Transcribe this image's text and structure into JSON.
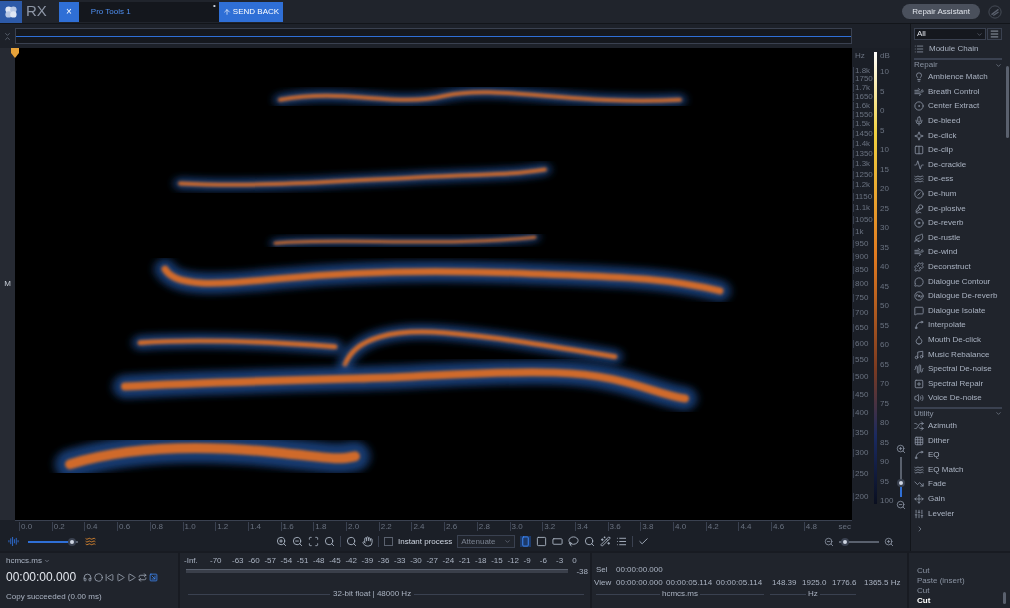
{
  "app": {
    "logo": "RX"
  },
  "document_tab": {
    "close": "×",
    "title": "Pro Tools 1",
    "mark": "•"
  },
  "send_back_button": "SEND BACK",
  "repair_assistant_button": "Repair Assistant",
  "spectrogram": {
    "channel_label": "M"
  },
  "frequency_axis": {
    "unit": "Hz",
    "labels": [
      "1.8k",
      "1750",
      "1.7k",
      "1650",
      "1.6k",
      "1550",
      "1.5k",
      "1450",
      "1.4k",
      "1350",
      "1.3k",
      "1250",
      "1.2k",
      "1150",
      "1.1k",
      "1050",
      "1k",
      "950",
      "900",
      "850",
      "800",
      "750",
      "700",
      "650",
      "600",
      "550",
      "500",
      "450",
      "400",
      "350",
      "300",
      "250",
      "200"
    ]
  },
  "level_axis": {
    "unit": "dB",
    "labels": [
      "10",
      "5",
      "0",
      "5",
      "10",
      "15",
      "20",
      "25",
      "30",
      "35",
      "40",
      "45",
      "50",
      "55",
      "60",
      "65",
      "70",
      "75",
      "80",
      "85",
      "90",
      "95",
      "100"
    ]
  },
  "vertical_zoom": {
    "level": 0.3
  },
  "time_axis": {
    "labels": [
      "0.0",
      "0.2",
      "0.4",
      "0.6",
      "0.8",
      "1.0",
      "1.2",
      "1.4",
      "1.6",
      "1.8",
      "2.0",
      "2.2",
      "2.4",
      "2.6",
      "2.8",
      "3.0",
      "3.2",
      "3.4",
      "3.6",
      "3.8",
      "4.0",
      "4.2",
      "4.4",
      "4.6",
      "4.8"
    ],
    "unit": "sec"
  },
  "display_blend": {
    "level": 0.95
  },
  "horizontal_zoom": {
    "level": 0.05
  },
  "toolbar": {
    "instant_process": {
      "label": "Instant process",
      "checked": false
    },
    "mode": "Attenuate",
    "selection_tools": [
      {
        "selected": true
      },
      {
        "selected": false
      },
      {
        "selected": false
      },
      {
        "selected": false
      },
      {
        "selected": false
      },
      {
        "selected": false
      },
      {
        "selected": false
      }
    ]
  },
  "transport": {
    "file": "hcmcs.ms",
    "time": "00:00:00.000",
    "status": "Copy succeeded (0.00 ms)",
    "buttons": [
      {
        "selected": false
      },
      {
        "selected": false
      },
      {
        "selected": false
      },
      {
        "selected": false
      },
      {
        "selected": false
      },
      {
        "selected": false
      },
      {
        "selected": true
      }
    ]
  },
  "meter": {
    "labels": [
      "-Inf.",
      "-70",
      "-63",
      "-60",
      "-57",
      "-54",
      "-51",
      "-48",
      "-45",
      "-42",
      "-39",
      "-36",
      "-33",
      "-30",
      "-27",
      "-24",
      "-21",
      "-18",
      "-15",
      "-12",
      "-9",
      "-6",
      "-3",
      "0"
    ],
    "reading": "-38",
    "format": "32-bit float | 48000 Hz"
  },
  "selection_info": {
    "sel_label": "Sel",
    "sel_start": "00:00:00.000",
    "view_label": "View",
    "view_values": [
      "00:00:00.000",
      "00:00:05.114",
      "00:00:05.114"
    ],
    "time_unit": "hcmcs.ms",
    "freq_values": [
      "148.39",
      "1925.0",
      "1776.6"
    ],
    "freq_unit": "Hz",
    "extra": "1365.5 Hz"
  },
  "history": [
    {
      "label": "Cut",
      "selected": false
    },
    {
      "label": "Paste (insert)",
      "selected": false
    },
    {
      "label": "Cut",
      "selected": false
    },
    {
      "label": "Cut",
      "selected": true
    }
  ],
  "modules": {
    "filter": "All",
    "module_chain": "Module Chain",
    "sections": [
      {
        "title": "Repair",
        "expanded": true,
        "items": [
          "Ambience Match",
          "Breath Control",
          "Center Extract",
          "De-bleed",
          "De-click",
          "De-clip",
          "De-crackle",
          "De-ess",
          "De-hum",
          "De-plosive",
          "De-reverb",
          "De-rustle",
          "De-wind",
          "Deconstruct",
          "Dialogue Contour",
          "Dialogue De-reverb",
          "Dialogue Isolate",
          "Interpolate",
          "Mouth De-click",
          "Music Rebalance",
          "Spectral De-noise",
          "Spectral Repair",
          "Voice De-noise"
        ]
      },
      {
        "title": "Utility",
        "expanded": true,
        "items": [
          "Azimuth",
          "Dither",
          "EQ",
          "EQ Match",
          "Fade",
          "Gain",
          "Leveler"
        ]
      }
    ]
  }
}
